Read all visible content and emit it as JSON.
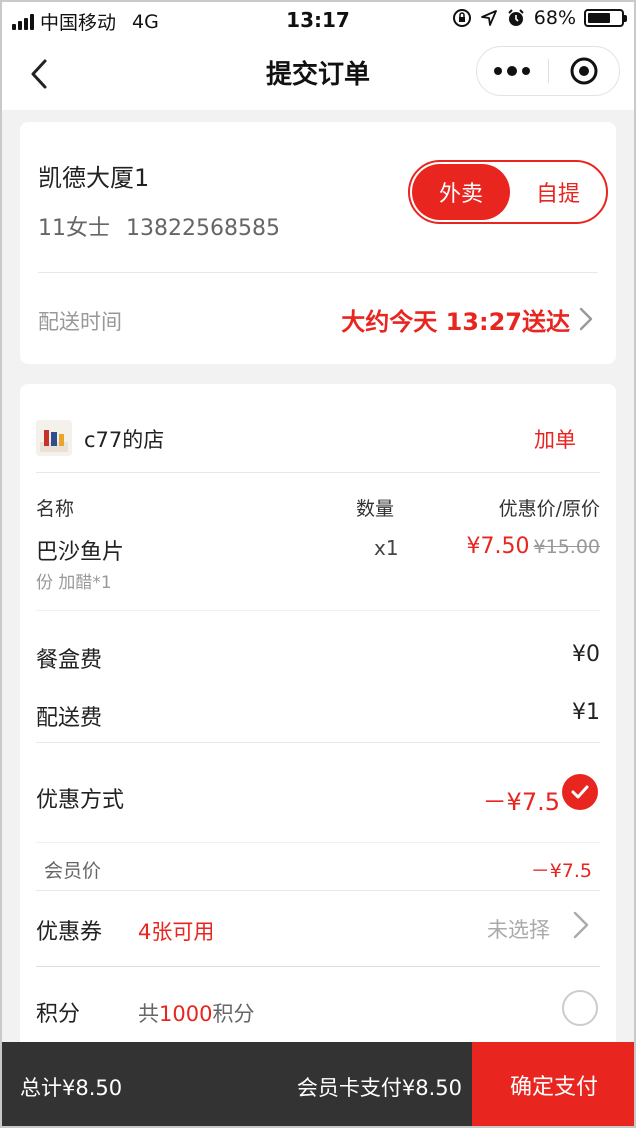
{
  "status_bar": {
    "carrier": "中国移动",
    "network": "4G",
    "time": "13:17",
    "battery": "68%",
    "battery_level": 0.68
  },
  "nav": {
    "title": "提交订单",
    "back_icon": "chevron-left-icon",
    "more_icon": "more-dots-icon",
    "target_icon": "target-icon"
  },
  "delivery_card": {
    "address_name": "凯德大厦1",
    "contact_name": "11女士",
    "contact_phone": "13822568585",
    "mode_options": [
      "外卖",
      "自提"
    ],
    "mode_selected": "外卖",
    "time_label": "配送时间",
    "time_value": "大约今天 13:27送达"
  },
  "order_card": {
    "shop_name": "c77的店",
    "add_order_label": "加单",
    "headers": {
      "name": "名称",
      "qty": "数量",
      "price": "优惠价/原价"
    },
    "item": {
      "name": "巴沙鱼片",
      "spec": "份 加醋*1",
      "qty": "x1",
      "price": "¥7.50",
      "orig_price": "¥15.00"
    },
    "box_fee_label": "餐盒费",
    "box_fee_value": "¥0",
    "delivery_fee_label": "配送费",
    "delivery_fee_value": "¥1",
    "discount_label": "优惠方式",
    "discount_value": "－¥7.5",
    "member_label": "会员价",
    "member_value": "－¥7.5",
    "coupon_label": "优惠券",
    "coupon_count": "4张可用",
    "coupon_status": "未选择",
    "points_label": "积分",
    "points_prefix": "共",
    "points_amount": "1000",
    "points_suffix": "积分"
  },
  "bottom_bar": {
    "total": "总计¥8.50",
    "member_card_pay": "会员卡支付¥8.50",
    "confirm_label": "确定支付"
  },
  "colors": {
    "accent": "#e8251f",
    "bottom_bar": "#333333"
  }
}
